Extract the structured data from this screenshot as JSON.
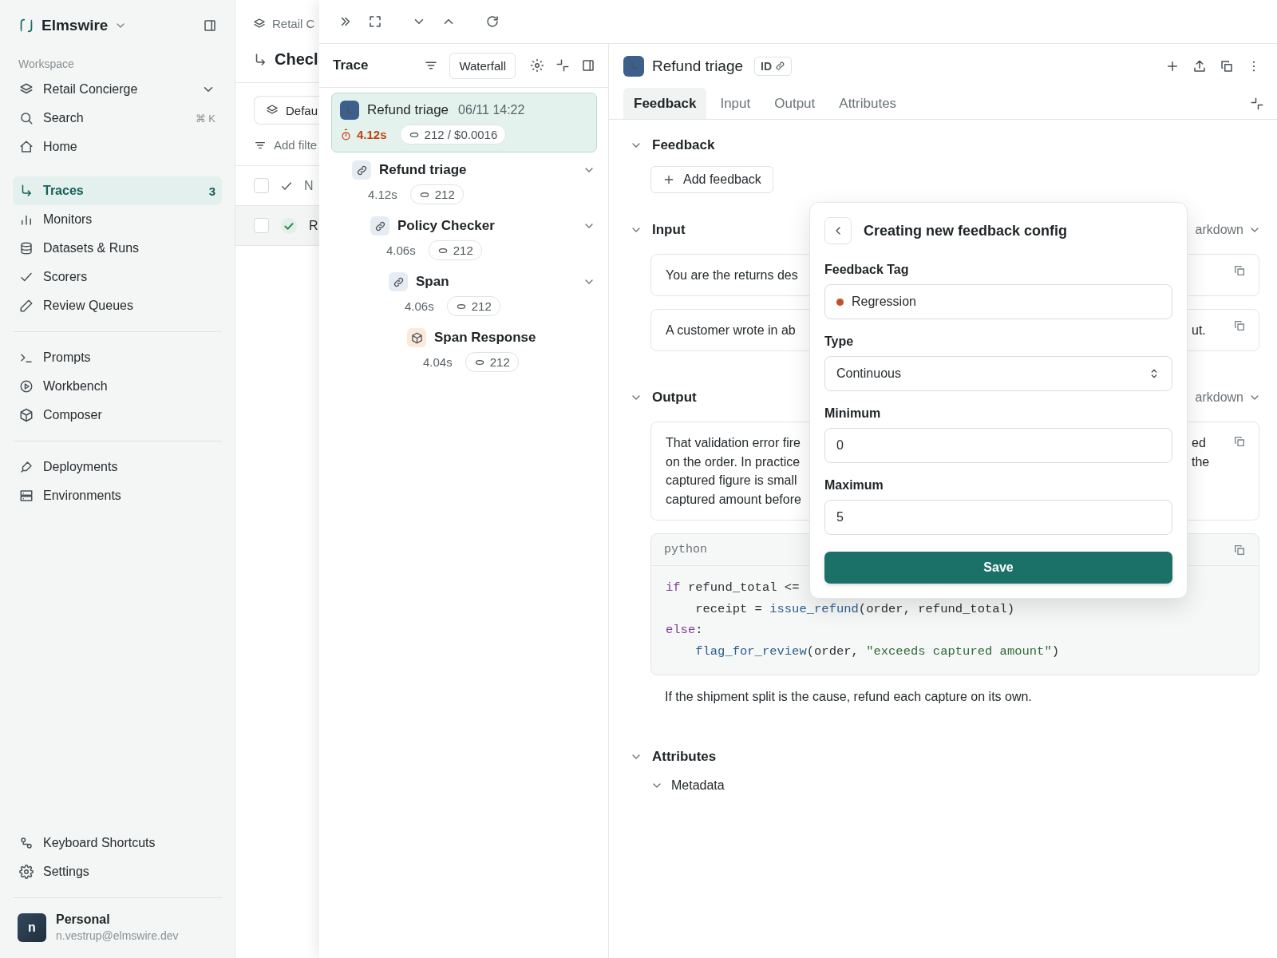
{
  "sidebar": {
    "brand": "Elmswire",
    "section_label": "Workspace",
    "project": "Retail Concierge",
    "groups": [
      [
        {
          "label": "Search",
          "shortcut": "⌘ K",
          "selected": false
        },
        {
          "label": "Home",
          "selected": false
        }
      ],
      [
        {
          "label": "Traces",
          "count": "3",
          "selected": true
        },
        {
          "label": "Monitors",
          "selected": false
        },
        {
          "label": "Datasets & Runs",
          "selected": false
        },
        {
          "label": "Scorers",
          "selected": false
        },
        {
          "label": "Review Queues",
          "selected": false
        }
      ],
      [
        {
          "label": "Prompts",
          "selected": false
        },
        {
          "label": "Workbench",
          "selected": false
        },
        {
          "label": "Composer",
          "selected": false
        }
      ],
      [
        {
          "label": "Deployments",
          "selected": false
        },
        {
          "label": "Environments",
          "selected": false
        }
      ]
    ],
    "footer_items": [
      {
        "label": "Keyboard Shortcuts",
        "selected": false
      },
      {
        "label": "Settings",
        "selected": false
      }
    ],
    "user": {
      "initial": "n",
      "name": "Personal",
      "email": "n.vestrup@elmswire.dev"
    }
  },
  "background_page": {
    "breadcrumb": "Retail C",
    "title": "Checl",
    "view_button": "Defau",
    "filter_button": "Add filte",
    "table": {
      "header": {
        "checked": false,
        "column_3": "N"
      },
      "rows": [
        {
          "checked": false,
          "selected": true,
          "column_3": "R"
        }
      ]
    }
  },
  "trace": {
    "title": "Trace",
    "view_button": "Waterfall",
    "root": {
      "name": "Refund triage",
      "time": "06/11 14:22",
      "duration": "4.12s",
      "usage": "212 / $0.0016",
      "selected": true
    },
    "spans": [
      {
        "kind": "link",
        "name": "Refund triage",
        "duration": "4.12s",
        "tokens": "212",
        "expanded": true,
        "children": [
          {
            "kind": "link",
            "name": "Policy Checker",
            "duration": "4.06s",
            "tokens": "212",
            "expanded": true,
            "children": [
              {
                "kind": "link",
                "name": "Span",
                "duration": "4.06s",
                "tokens": "212",
                "expanded": true,
                "children": [
                  {
                    "kind": "response",
                    "name": "Span Response",
                    "duration": "4.04s",
                    "tokens": "212"
                  }
                ]
              }
            ]
          }
        ]
      }
    ]
  },
  "detail": {
    "title": "Refund triage",
    "id_badge": "ID",
    "tabs": [
      {
        "label": "Feedback",
        "selected": true
      },
      {
        "label": "Input",
        "selected": false
      },
      {
        "label": "Output",
        "selected": false
      },
      {
        "label": "Attributes",
        "selected": false
      }
    ],
    "feedback": {
      "title": "Feedback",
      "expanded": true,
      "button": "Add feedback"
    },
    "input": {
      "title": "Input",
      "expanded": true,
      "format": "arkdown",
      "messages": [
        {
          "left": "You are the returns des"
        },
        {
          "left": "A customer wrote in ab",
          "right": "ut."
        }
      ]
    },
    "output": {
      "title": "Output",
      "expanded": true,
      "format": "arkdown",
      "message": [
        {
          "left": "That validation error fire",
          "right": "ed"
        },
        {
          "left": "on the order. In practice",
          "right": "the"
        },
        {
          "left": "captured figure is small"
        },
        {
          "left": "captured amount before"
        }
      ],
      "code": {
        "language": "python",
        "lines": [
          {
            "indented": false,
            "tokens": [
              {
                "kind": "keyword",
                "text": "if"
              },
              {
                "kind": "plain",
                "text": " refund_total <="
              }
            ]
          },
          {
            "indented": true,
            "tokens": [
              {
                "kind": "plain",
                "text": "receipt = "
              },
              {
                "kind": "function",
                "text": "issue_refund"
              },
              {
                "kind": "plain",
                "text": "(order, refund_total)"
              }
            ]
          },
          {
            "indented": false,
            "tokens": [
              {
                "kind": "keyword",
                "text": "else"
              },
              {
                "kind": "plain",
                "text": ":"
              }
            ]
          },
          {
            "indented": true,
            "tokens": [
              {
                "kind": "function",
                "text": "flag_for_review"
              },
              {
                "kind": "plain",
                "text": "(order, "
              },
              {
                "kind": "string",
                "text": "\"exceeds captured amount\""
              },
              {
                "kind": "plain",
                "text": ")"
              }
            ]
          }
        ]
      },
      "paragraph": "If the shipment split is the cause, refund each capture on its own."
    },
    "attributes": {
      "title": "Attributes",
      "expanded": true,
      "children": [
        {
          "title": "Metadata",
          "expanded": true
        }
      ]
    }
  },
  "popover": {
    "title": "Creating new feedback config",
    "fields": [
      {
        "kind": "tag",
        "label": "Feedback Tag",
        "value": "Regression",
        "color": "#c0522a"
      },
      {
        "kind": "select",
        "label": "Type",
        "value": "Continuous"
      },
      {
        "kind": "number",
        "label": "Minimum",
        "value": "0"
      },
      {
        "kind": "number",
        "label": "Maximum",
        "value": "5"
      }
    ],
    "submit": "Save"
  }
}
